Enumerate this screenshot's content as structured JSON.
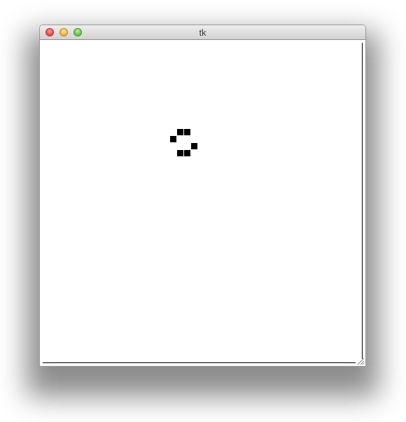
{
  "window": {
    "title": "tk",
    "buttons": {
      "close": "close-button",
      "minimize": "minimize-button",
      "zoom": "zoom-button"
    }
  },
  "canvas": {
    "background": "#ffffff",
    "cell_color": "#000000",
    "live_cells": [
      {
        "row": 0,
        "col": 1
      },
      {
        "row": 0,
        "col": 2
      },
      {
        "row": 1,
        "col": 0
      },
      {
        "row": 2,
        "col": 3
      },
      {
        "row": 3,
        "col": 1
      },
      {
        "row": 3,
        "col": 2
      }
    ]
  },
  "icons": [
    "close-icon",
    "minimize-icon",
    "zoom-icon",
    "resize-grip-icon"
  ]
}
